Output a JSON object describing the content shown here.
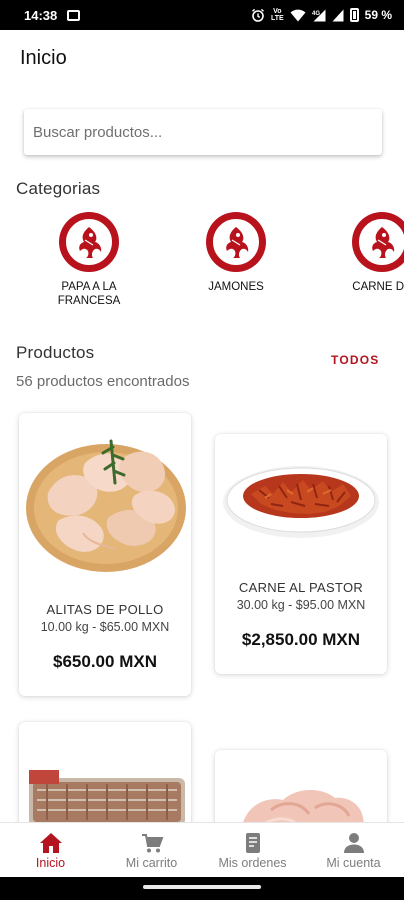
{
  "status_bar": {
    "time": "14:38",
    "battery": "59 %"
  },
  "header": {
    "title": "Inicio"
  },
  "search": {
    "placeholder": "Buscar productos..."
  },
  "categories_section": {
    "title": "Categorias",
    "items": [
      {
        "label": "PAPA A LA\nFRANCESA",
        "icon": "brand-logo"
      },
      {
        "label": "JAMONES",
        "icon": "brand-logo"
      },
      {
        "label": "CARNE DE",
        "icon": "brand-logo"
      }
    ]
  },
  "products_section": {
    "title": "Productos",
    "see_all": "TODOS",
    "count": "56 productos encontrados",
    "items": [
      {
        "name": "ALITAS DE POLLO",
        "detail": "10.00 kg - $65.00 MXN",
        "price": "$650.00 MXN",
        "image": "chicken-wings"
      },
      {
        "name": "CARNE AL PASTOR",
        "detail": "30.00 kg - $95.00 MXN",
        "price": "$2,850.00 MXN",
        "image": "pastor-meat"
      },
      {
        "image": "packaged-meat"
      },
      {
        "image": "raw-meat"
      }
    ]
  },
  "bottom_nav": [
    {
      "label": "Inicio",
      "icon": "home-icon",
      "active": true
    },
    {
      "label": "Mi carrito",
      "icon": "cart-icon",
      "active": false
    },
    {
      "label": "Mis ordenes",
      "icon": "orders-icon",
      "active": false
    },
    {
      "label": "Mi cuenta",
      "icon": "account-icon",
      "active": false
    }
  ],
  "colors": {
    "accent": "#b3141f",
    "brand_red": "#b8121d"
  }
}
